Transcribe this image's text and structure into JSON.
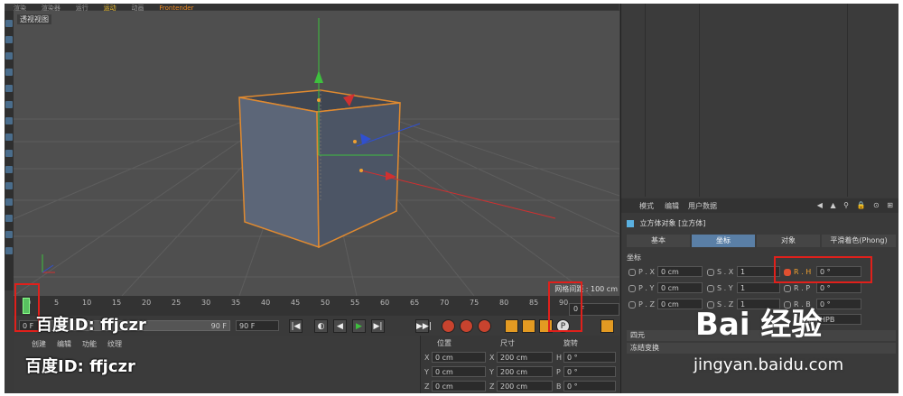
{
  "menubar": {
    "items": [
      "渲染",
      "渲染器",
      "运行",
      "运动",
      "动画",
      "Frontender"
    ]
  },
  "viewport": {
    "label": "透视视图",
    "grid_distance": "网格间距 : 100 cm"
  },
  "timeline": {
    "ticks": [
      "0",
      "5",
      "10",
      "15",
      "20",
      "25",
      "30",
      "35",
      "40",
      "45",
      "50",
      "55",
      "60",
      "65",
      "70",
      "75",
      "80",
      "85",
      "90"
    ],
    "current_frame": "0 F",
    "end_frame_right": "0 F"
  },
  "controls": {
    "start_frame": "0 F",
    "slider_value": "90 F",
    "end_frame": "90 F",
    "buttons": [
      "|◀",
      "◐",
      "◀",
      "▶",
      "▶|",
      "▶▶|"
    ]
  },
  "bottom": {
    "menu": [
      "创建",
      "编辑",
      "功能",
      "纹理"
    ],
    "coords": {
      "headers": [
        "位置",
        "尺寸",
        "旋转"
      ],
      "rows": [
        {
          "axis": "X",
          "pos": "0 cm",
          "size": "200 cm",
          "rot_axis": "H",
          "rot": "0 °"
        },
        {
          "axis": "Y",
          "pos": "0 cm",
          "size": "200 cm",
          "rot_axis": "P",
          "rot": "0 °"
        },
        {
          "axis": "Z",
          "pos": "0 cm",
          "size": "200 cm",
          "rot_axis": "B",
          "rot": "0 °"
        }
      ]
    }
  },
  "attributes": {
    "menu": [
      "模式",
      "编辑",
      "用户数据"
    ],
    "object_title": "立方体对象 [立方体]",
    "tabs": [
      "基本",
      "坐标",
      "对象",
      "平滑着色(Phong)"
    ],
    "active_tab": "坐标",
    "section": "坐标",
    "rows": [
      {
        "p_label": "P . X",
        "p_val": "0 cm",
        "s_label": "S . X",
        "s_val": "1",
        "r_label": "R . H",
        "r_val": "0 °"
      },
      {
        "p_label": "P . Y",
        "p_val": "0 cm",
        "s_label": "S . Y",
        "s_val": "1",
        "r_label": "R . P",
        "r_val": "0 °"
      },
      {
        "p_label": "P . Z",
        "p_val": "0 cm",
        "s_label": "S . Z",
        "s_val": "1",
        "r_label": "R . B",
        "r_val": "0 °"
      }
    ],
    "order_label": "顺序",
    "order_value": "HPB",
    "sub1": "四元",
    "sub2": "冻结变换"
  },
  "watermark": {
    "left1": "百度ID: ffjczr",
    "left2": "百度ID: ffjczr",
    "brand": "Bai 经验",
    "url": "jingyan.baidu.com"
  },
  "colors": {
    "accent": "#5a7fa6",
    "highlight": "#e0201b",
    "selection": "#f0a030"
  }
}
